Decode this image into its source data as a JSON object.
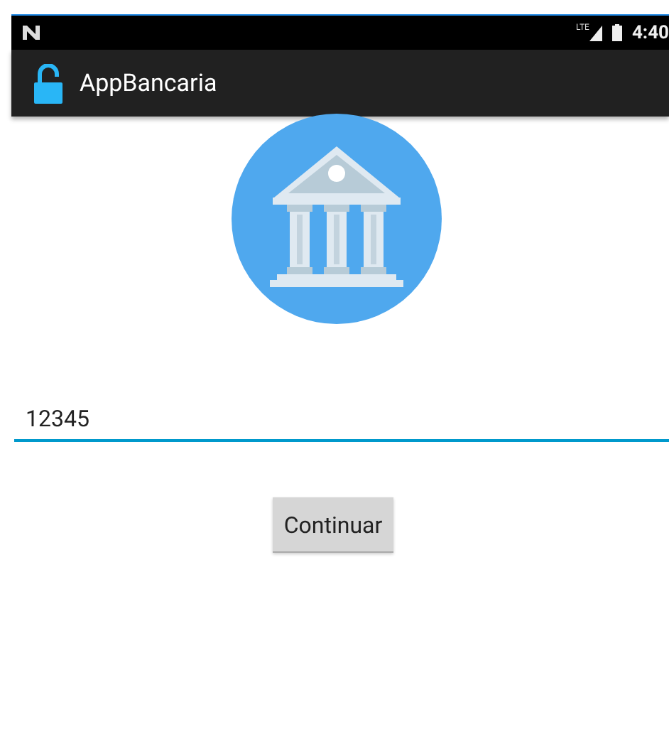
{
  "status_bar": {
    "time": "4:40",
    "network": "LTE"
  },
  "app_bar": {
    "title": "AppBancaria"
  },
  "account_field": {
    "value": "12345",
    "focused": true
  },
  "buttons": [
    "Continuar"
  ]
}
